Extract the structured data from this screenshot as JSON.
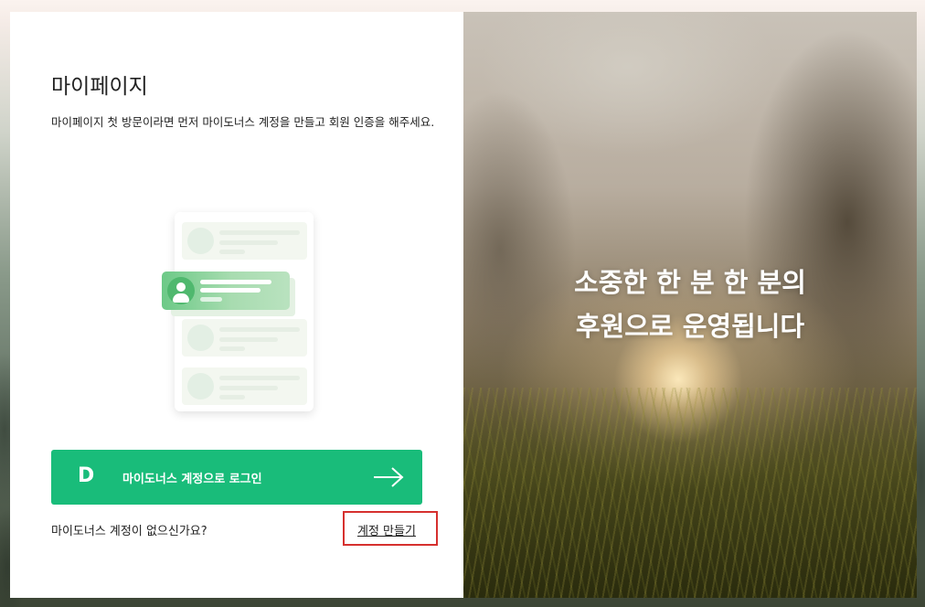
{
  "login_panel": {
    "title": "마이페이지",
    "description": "마이페이지 첫 방문이라면 먼저 마이도너스 계정을 만들고 회원 인증을 해주세요.",
    "login_button": {
      "logo_letter": "D",
      "label": "마이도너스 계정으로 로그인"
    },
    "no_account_text": "마이도너스 계정이 없으신가요?",
    "signup_link": "계정 만들기"
  },
  "hero": {
    "line1": "소중한 한 분 한 분의",
    "line2": "후원으로 운영됩니다"
  },
  "colors": {
    "accent": "#19bc7a",
    "highlight_box": "#d6302e"
  }
}
